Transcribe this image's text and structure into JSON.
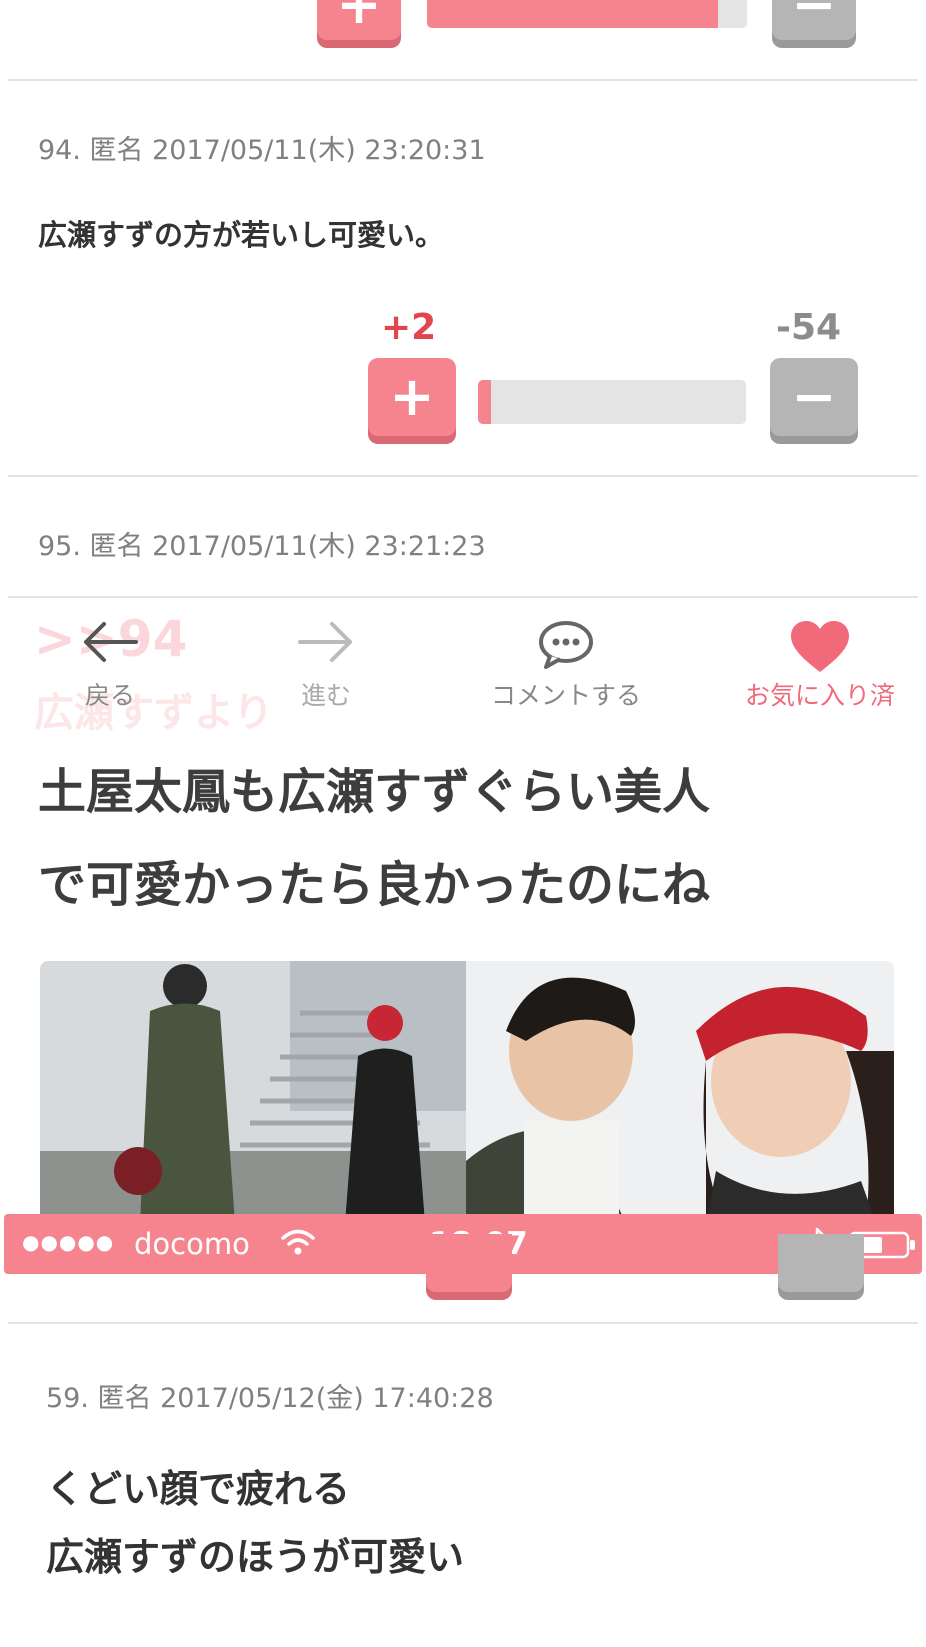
{
  "comments": [
    {
      "meta": "94. 匿名 2017/05/11(木) 23:20:31",
      "text": "広瀬すずの方が若いし可愛い。",
      "plus": "+2",
      "minus": "-54",
      "plus_share": 0.036
    },
    {
      "meta": "95. 匿名 2017/05/11(木) 23:21:23"
    },
    {
      "meta": "59. 匿名 2017/05/12(金) 17:40:28",
      "lines": [
        "くどい顔で疲れる",
        "広瀬すずのほうが可愛い"
      ]
    }
  ],
  "vote_buttons": {
    "plus_glyph": "+",
    "minus_glyph": "−"
  },
  "nav": {
    "back": "戻る",
    "forward": "進む",
    "comment": "コメントする",
    "favorite": "お気に入り済",
    "icons": [
      "back-arrow-icon",
      "forward-arrow-icon",
      "speech-bubble-icon",
      "heart-icon"
    ]
  },
  "ghost_text": {
    "anchor": ">>94",
    "body": "広瀬すずより"
  },
  "headline": {
    "lines": [
      "土屋太鳳も広瀬すずぐらい美人",
      "で可愛かったら良かったのにね"
    ]
  },
  "status_bar": {
    "signal": "●●●●●",
    "carrier": "docomo",
    "time": "18:07"
  },
  "colors": {
    "accent": "#f5848f",
    "plus_count": "#e2454e",
    "minus_button": "#b5b5b5"
  }
}
